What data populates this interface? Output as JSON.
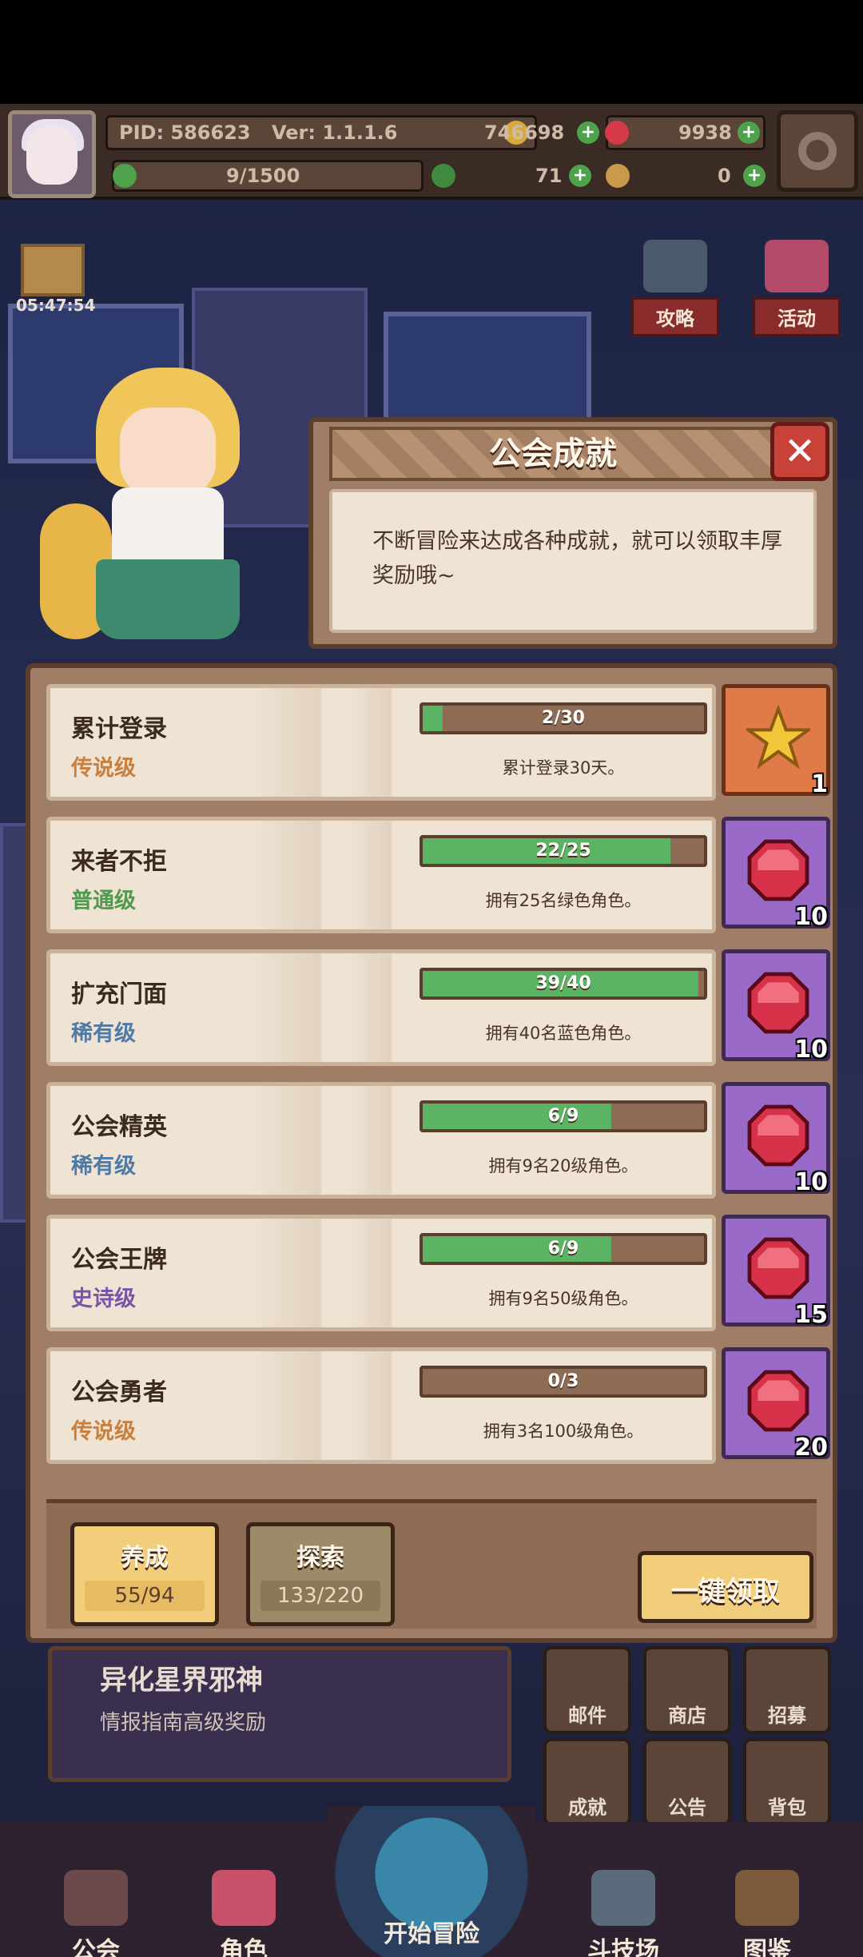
{
  "header": {
    "pid": "PID: 586623",
    "version": "Ver: 1.1.1.6",
    "gold": "746698",
    "gems": "9938",
    "stamina": "9/1500",
    "clover": "71",
    "keys": "0"
  },
  "hud": {
    "timer": "05:47:54",
    "strategy_label": "攻略",
    "event_label": "活动"
  },
  "dialog": {
    "title": "公会成就",
    "body": "不断冒险来达成各种成就，就可以领取丰厚奖励哦~"
  },
  "achievements": [
    {
      "name": "累计登录",
      "grade": "传说级",
      "grade_color": "#c8803e",
      "progress_text": "2/30",
      "progress": 0.0667,
      "desc": "累计登录30天。",
      "reward_type": "star",
      "reward_count": "1"
    },
    {
      "name": "来者不拒",
      "grade": "普通级",
      "grade_color": "#4f9a4c",
      "progress_text": "22/25",
      "progress": 0.88,
      "desc": "拥有25名绿色角色。",
      "reward_type": "gem",
      "reward_count": "10"
    },
    {
      "name": "扩充门面",
      "grade": "稀有级",
      "grade_color": "#4e7aa8",
      "progress_text": "39/40",
      "progress": 0.975,
      "desc": "拥有40名蓝色角色。",
      "reward_type": "gem",
      "reward_count": "10"
    },
    {
      "name": "公会精英",
      "grade": "稀有级",
      "grade_color": "#4e7aa8",
      "progress_text": "6/9",
      "progress": 0.6667,
      "desc": "拥有9名20级角色。",
      "reward_type": "gem",
      "reward_count": "10"
    },
    {
      "name": "公会王牌",
      "grade": "史诗级",
      "grade_color": "#7a54a8",
      "progress_text": "6/9",
      "progress": 0.6667,
      "desc": "拥有9名50级角色。",
      "reward_type": "gem",
      "reward_count": "15"
    },
    {
      "name": "公会勇者",
      "grade": "传说级",
      "grade_color": "#c8803e",
      "progress_text": "0/3",
      "progress": 0,
      "desc": "拥有3名100级角色。",
      "reward_type": "gem",
      "reward_count": "20"
    }
  ],
  "footer": {
    "train_label": "养成",
    "train_value": "55/94",
    "explore_label": "探索",
    "explore_value": "133/220",
    "claim_all_label": "一键领取"
  },
  "background_ui": {
    "news_title": "异化星界邪神",
    "news_sub": "情报指南高级奖励",
    "grid": [
      "邮件",
      "商店",
      "招募",
      "成就",
      "公告",
      "背包"
    ]
  },
  "nav": {
    "guild": "公会",
    "characters": "角色",
    "adventure": "开始冒险",
    "arena": "斗技场",
    "codex": "图鉴"
  },
  "colors": {
    "progress_fill": "#5ab463",
    "reward_gold": "#e07a48",
    "reward_purple": "#9a6ac8"
  }
}
